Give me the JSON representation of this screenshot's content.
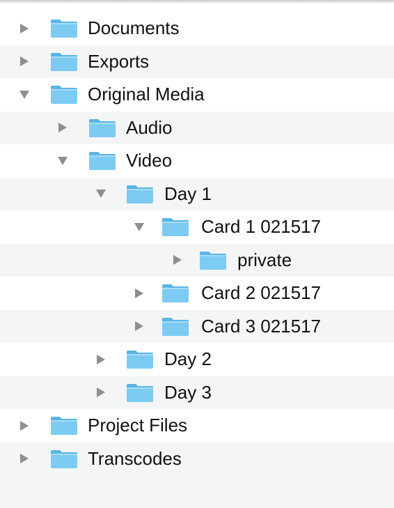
{
  "tree": {
    "items": [
      {
        "label": "Documents",
        "expanded": false,
        "icon": "folder-icon",
        "depth": 0
      },
      {
        "label": "Exports",
        "expanded": false,
        "icon": "folder-icon",
        "depth": 0
      },
      {
        "label": "Original Media",
        "expanded": true,
        "icon": "folder-icon",
        "depth": 0
      },
      {
        "label": "Audio",
        "expanded": false,
        "icon": "folder-icon",
        "depth": 1
      },
      {
        "label": "Video",
        "expanded": true,
        "icon": "folder-icon",
        "depth": 1
      },
      {
        "label": "Day 1",
        "expanded": true,
        "icon": "folder-icon",
        "depth": 2
      },
      {
        "label": "Card 1 021517",
        "expanded": true,
        "icon": "folder-icon",
        "depth": 3
      },
      {
        "label": "private",
        "expanded": false,
        "icon": "folder-icon",
        "depth": 4
      },
      {
        "label": "Card 2 021517",
        "expanded": false,
        "icon": "folder-icon",
        "depth": 3
      },
      {
        "label": "Card 3 021517",
        "expanded": false,
        "icon": "folder-icon",
        "depth": 3
      },
      {
        "label": "Day 2",
        "expanded": false,
        "icon": "folder-icon",
        "depth": 2
      },
      {
        "label": "Day 3",
        "expanded": false,
        "icon": "folder-icon",
        "depth": 2
      },
      {
        "label": "Project Files",
        "expanded": false,
        "icon": "folder-icon",
        "depth": 0
      },
      {
        "label": "Transcodes",
        "expanded": false,
        "icon": "folder-icon",
        "depth": 0
      }
    ]
  },
  "colors": {
    "folder_body": "#7ccbf3",
    "folder_tab": "#5ab4e6",
    "disclosure": "#8e8e8e",
    "alt_row": "#f4f5f5"
  }
}
